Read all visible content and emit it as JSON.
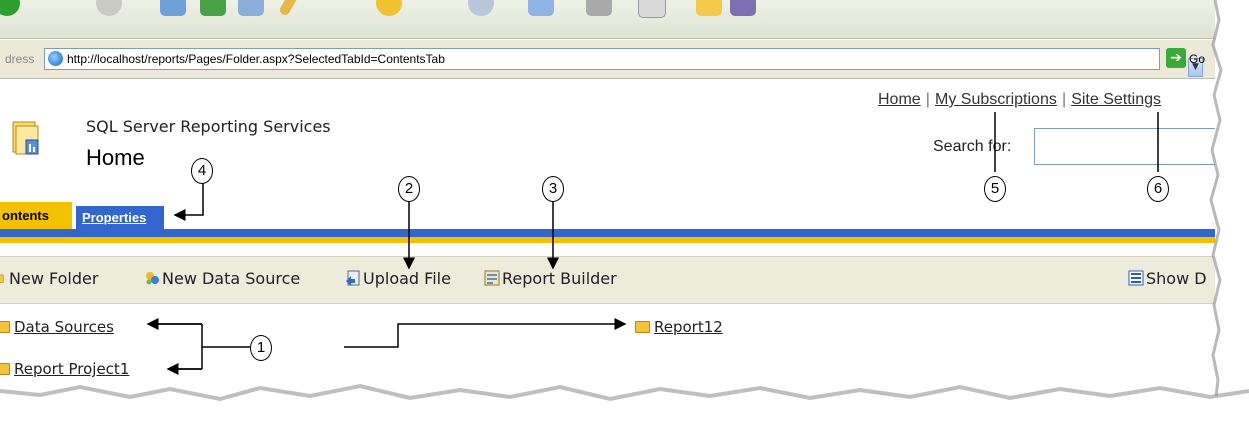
{
  "browser": {
    "address_label": "dress",
    "url": "http://localhost/reports/Pages/Folder.aspx?SelectedTabId=ContentsTab",
    "go_label": "Go"
  },
  "header": {
    "links": [
      "Home",
      "My Subscriptions",
      "Site Settings"
    ],
    "separator": "|",
    "app_name": "SQL Server Reporting Services",
    "title": "Home",
    "search_label": "Search for:",
    "search_value": ""
  },
  "tabs": {
    "contents": "ontents",
    "properties": "Properties"
  },
  "toolbar": {
    "new_folder": "New Folder",
    "new_data_source": "New Data Source",
    "upload_file": "Upload File",
    "report_builder": "Report Builder",
    "show_details": "Show D"
  },
  "items": {
    "data_sources": "Data Sources",
    "report_project": "Report Project1",
    "report12": "Report12"
  },
  "callouts": [
    "1",
    "2",
    "3",
    "4",
    "5",
    "6"
  ]
}
